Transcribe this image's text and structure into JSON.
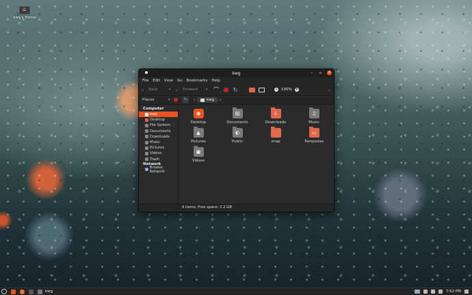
{
  "desktop": {
    "icon_label": "kwg's Home"
  },
  "window": {
    "title": "kwg",
    "menu": [
      "File",
      "Edit",
      "View",
      "Go",
      "Bookmarks",
      "Help"
    ],
    "toolbar": {
      "back_label": "Back",
      "forward_label": "Forward",
      "zoom": "100%"
    },
    "location": {
      "places_label": "Places",
      "crumb": "kwg"
    },
    "sidebar": {
      "computer_header": "Computer",
      "computer_items": [
        {
          "label": "kwg",
          "icon": "home-icon",
          "selected": true
        },
        {
          "label": "Desktop",
          "icon": "desktop-folder-icon"
        },
        {
          "label": "File System",
          "icon": "drive-icon"
        },
        {
          "label": "Documents",
          "icon": "folder-icon"
        },
        {
          "label": "Downloads",
          "icon": "folder-icon"
        },
        {
          "label": "Music",
          "icon": "folder-icon"
        },
        {
          "label": "Pictures",
          "icon": "folder-icon"
        },
        {
          "label": "Videos",
          "icon": "folder-icon"
        },
        {
          "label": "Trash",
          "icon": "trash-icon"
        }
      ],
      "network_header": "Network",
      "network_items": [
        {
          "label": "Browse Network",
          "icon": "network-icon"
        }
      ]
    },
    "files": [
      {
        "name": "Desktop",
        "icon": "desktop-folder-icon"
      },
      {
        "name": "Documents",
        "icon": "documents-folder-icon"
      },
      {
        "name": "Downloads",
        "icon": "downloads-folder-icon"
      },
      {
        "name": "Music",
        "icon": "music-folder-icon"
      },
      {
        "name": "Pictures",
        "icon": "pictures-folder-icon"
      },
      {
        "name": "Public",
        "icon": "public-folder-icon"
      },
      {
        "name": "snap",
        "icon": "folder-icon"
      },
      {
        "name": "Templates",
        "icon": "templates-folder-icon"
      },
      {
        "name": "Videos",
        "icon": "videos-folder-icon"
      }
    ],
    "status": "9 items, Free space: 2.2 GB"
  },
  "taskbar": {
    "window_label": "kwg",
    "clock": "7:52 PM"
  },
  "colors": {
    "accent": "#e95420",
    "folder_orange": "#e0684a",
    "window_bg": "#2b2b2b"
  }
}
